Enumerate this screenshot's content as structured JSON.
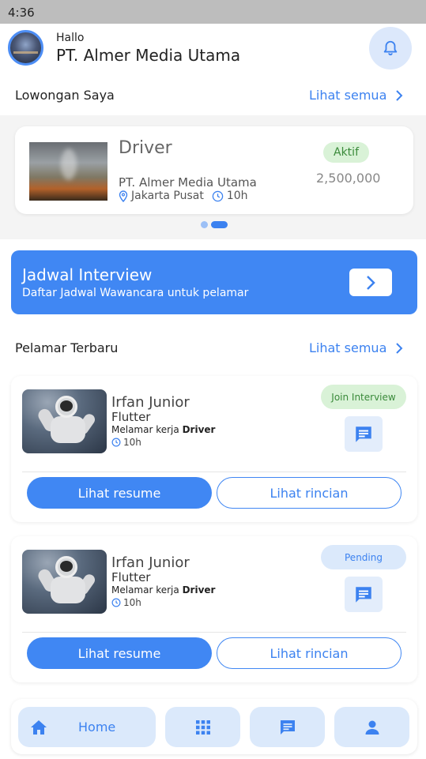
{
  "status_bar": {
    "time": "4:36"
  },
  "header": {
    "greeting": "Hallo",
    "company_name": "PT. Almer Media Utama"
  },
  "jobs_section": {
    "title": "Lowongan Saya",
    "see_all": "Lihat semua"
  },
  "job_card": {
    "title": "Driver",
    "company": "PT. Almer Media Utama",
    "location": "Jakarta Pusat",
    "time": "10h",
    "status": "Aktif",
    "salary": "2,500,000"
  },
  "interview_banner": {
    "title": "Jadwal Interview",
    "subtitle": "Daftar Jadwal Wawancara untuk pelamar"
  },
  "applicants_section": {
    "title": "Pelamar Terbaru",
    "see_all": "Lihat semua"
  },
  "applicants": [
    {
      "name": "Irfan Junior",
      "role": "Flutter",
      "applied_prefix": "Melamar kerja",
      "applied_job": "Driver",
      "time": "10h",
      "status": "Join Interview",
      "resume_label": "Lihat resume",
      "detail_label": "Lihat rincian"
    },
    {
      "name": "Irfan Junior",
      "role": "Flutter",
      "applied_prefix": "Melamar kerja",
      "applied_job": "Driver",
      "time": "10h",
      "status": "Pending",
      "resume_label": "Lihat resume",
      "detail_label": "Lihat rincian"
    }
  ],
  "bottom_nav": {
    "home_label": "Home",
    "icons": [
      "home-icon",
      "grid-icon",
      "chat-icon",
      "profile-icon"
    ]
  },
  "colors": {
    "primary": "#4087f3",
    "link": "#3c82f0",
    "active_badge_bg": "#d9f2d7",
    "pending_badge_bg": "#dbe9fb"
  }
}
